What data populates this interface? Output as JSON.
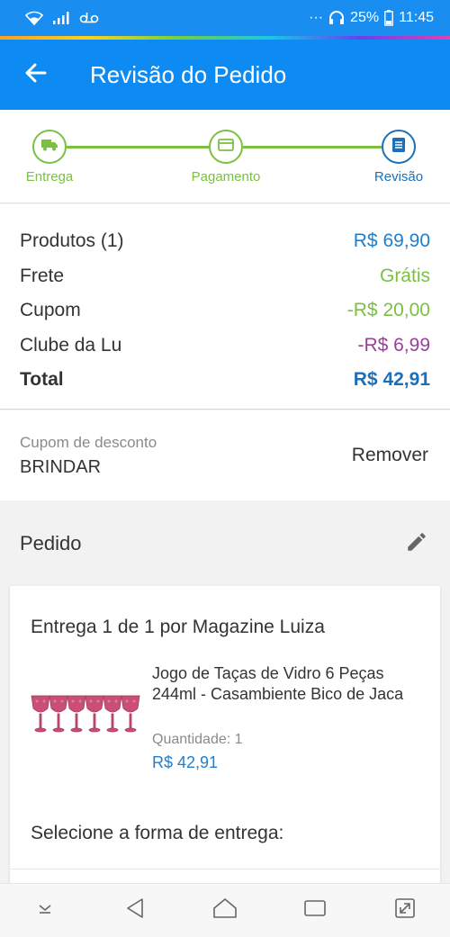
{
  "status": {
    "battery": "25%",
    "time": "11:45",
    "dots": "···"
  },
  "header": {
    "title": "Revisão do Pedido"
  },
  "steps": [
    {
      "label": "Entrega"
    },
    {
      "label": "Pagamento"
    },
    {
      "label": "Revisão"
    }
  ],
  "summary": {
    "rows": [
      {
        "label": "Produtos (1)",
        "value": "R$ 69,90",
        "color": "#1d7fd0"
      },
      {
        "label": "Frete",
        "value": "Grátis",
        "color": "#7ac143"
      },
      {
        "label": "Cupom",
        "value": "-R$ 20,00",
        "color": "#7ac143"
      },
      {
        "label": "Clube da Lu",
        "value": "-R$ 6,99",
        "color": "#9a3f9a"
      }
    ],
    "total_label": "Total",
    "total_value": "R$ 42,91",
    "total_color": "#1d6fb8"
  },
  "coupon": {
    "label": "Cupom de desconto",
    "code": "BRINDAR",
    "remove_label": "Remover"
  },
  "order": {
    "title": "Pedido",
    "delivery_title": "Entrega 1 de 1 por Magazine Luiza",
    "product": {
      "name": "Jogo de Taças de Vidro 6 Peças 244ml - Casambiente Bico de Jaca",
      "qty_label": "Quantidade:",
      "qty": "1",
      "price": "R$ 42,91"
    },
    "shipping_prompt": "Selecione a forma de entrega:"
  },
  "colors": {
    "primary": "#0d8bf2",
    "step_green": "#7ac143",
    "step_blue": "#1d6fb8"
  }
}
